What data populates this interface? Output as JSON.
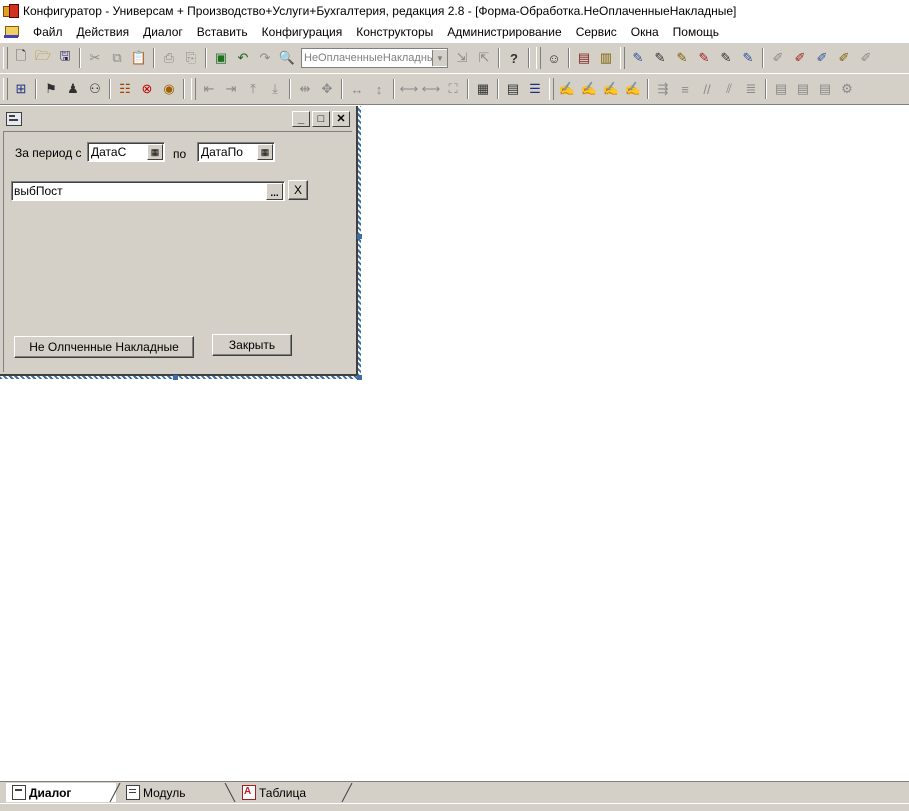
{
  "window": {
    "title": "Конфигуратор - Универсам + Производство+Услуги+Бухгалтерия, редакция 2.8 - [Форма-Обработка.НеОплаченныеНакладные]"
  },
  "menu": [
    "Файл",
    "Действия",
    "Диалог",
    "Вставить",
    "Конфигурация",
    "Конструкторы",
    "Администрирование",
    "Сервис",
    "Окна",
    "Помощь"
  ],
  "toolbar1": {
    "object_combo_value": "НеОплаченныеНакладнь"
  },
  "form": {
    "period_label": "За период с",
    "date_from_value": "ДатаС",
    "to_label": "по",
    "date_to_value": "ДатаПо",
    "supplier_value": "выбПост",
    "clear_button_label": "X",
    "unpaid_button_label": "Не Олпченные Накладные",
    "close_button_label": "Закрыть"
  },
  "tabs": [
    {
      "label": "Диалог",
      "icon": "dialog-icon",
      "active": true
    },
    {
      "label": "Модуль",
      "icon": "module-icon",
      "active": false
    },
    {
      "label": "Таблица",
      "icon": "table-icon",
      "active": false
    }
  ]
}
